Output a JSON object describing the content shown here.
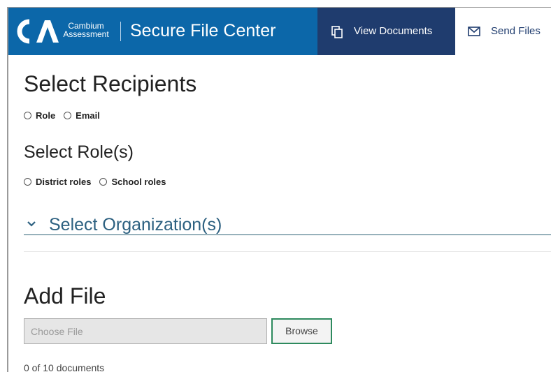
{
  "header": {
    "brand_line1": "Cambium",
    "brand_line2": "Assessment",
    "app_title": "Secure File Center",
    "nav": [
      {
        "label": "View Documents",
        "icon": "copy-icon"
      },
      {
        "label": "Send Files",
        "icon": "mail-icon"
      }
    ],
    "colors": {
      "brand_blue": "#0c67a9",
      "nav_active": "#1f3c6e"
    }
  },
  "recipients": {
    "heading": "Select Recipients",
    "options": [
      "Role",
      "Email"
    ]
  },
  "roles": {
    "heading": "Select Role(s)",
    "options": [
      "District roles",
      "School roles"
    ]
  },
  "organization": {
    "label": "Select Organization(s)",
    "icon": "chevron-down-icon"
  },
  "add_file": {
    "heading": "Add File",
    "placeholder": "Choose File",
    "browse_label": "Browse",
    "doc_count": "0 of 10 documents"
  }
}
